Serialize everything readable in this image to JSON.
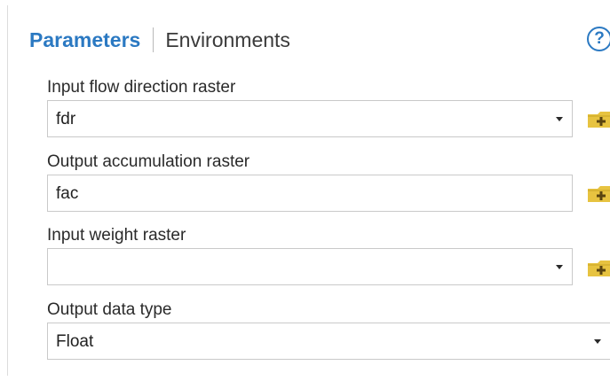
{
  "tabs": {
    "parameters": "Parameters",
    "environments": "Environments"
  },
  "help": {
    "glyph": "?",
    "icon": "help-icon"
  },
  "params": {
    "flow_direction": {
      "label": "Input flow direction raster",
      "value": "fdr"
    },
    "output_accumulation": {
      "label": "Output accumulation raster",
      "value": "fac"
    },
    "weight": {
      "label": "Input weight raster",
      "value": ""
    },
    "data_type": {
      "label": "Output data type",
      "value": "Float"
    }
  },
  "icons": {
    "browse": "folder-add-icon",
    "dropdown": "chevron-down-icon"
  },
  "colors": {
    "accent": "#2b79c2",
    "folder": "#e7c340"
  }
}
